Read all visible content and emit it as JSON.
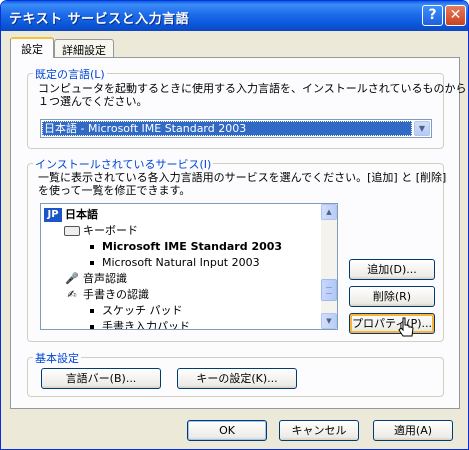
{
  "window": {
    "title": "テキスト サービスと入力言語"
  },
  "tabs": [
    {
      "label": "設定",
      "active": true
    },
    {
      "label": "詳細設定",
      "active": false
    }
  ],
  "default_language": {
    "group_label": "既定の言語(L)",
    "description_line1": "コンピュータを起動するときに使用する入力言語を、インストールされているものから",
    "description_line2": "１つ選んでください。",
    "selected_value": "日本語 - Microsoft IME Standard 2003"
  },
  "installed_services": {
    "group_label": "インストールされているサービス(I)",
    "description_line1": "一覧に表示されている各入力言語用のサービスを選んでください。[追加] と [削除]",
    "description_line2": "を使って一覧を修正できます。",
    "tree": {
      "language_code": "JP",
      "language": "日本語",
      "keyboard": "キーボード",
      "keyboard_items": [
        "Microsoft IME Standard 2003",
        "Microsoft Natural Input 2003"
      ],
      "speech": "音声認識",
      "handwriting": "手書きの認識",
      "handwriting_items": [
        "スケッチ パッド",
        "手書き入力パッド"
      ]
    },
    "buttons": {
      "add": "追加(D)...",
      "remove": "削除(R)",
      "properties": "プロパティ(P)..."
    }
  },
  "preferences": {
    "group_label": "基本設定",
    "language_bar_button": "言語バー(B)...",
    "key_settings_button": "キーの設定(K)..."
  },
  "footer": {
    "ok": "OK",
    "cancel": "キャンセル",
    "apply": "適用(A)"
  }
}
